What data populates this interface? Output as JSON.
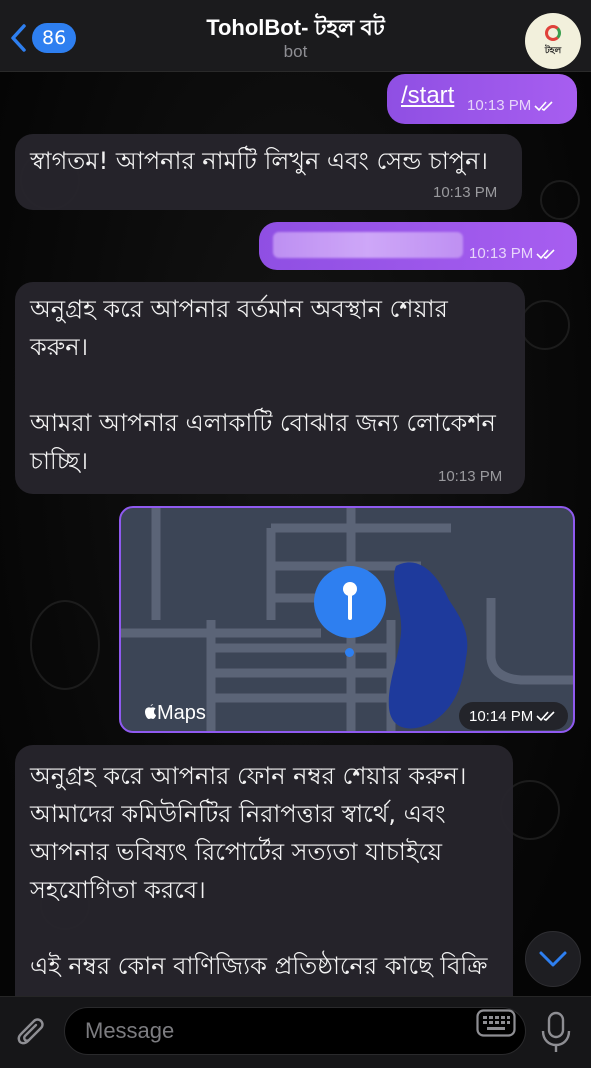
{
  "header": {
    "back_count": "86",
    "title": "ToholBot- টহল বট",
    "subtitle": "bot",
    "avatar_text": "টহল"
  },
  "messages": [
    {
      "direction": "out",
      "text": "/start",
      "time": "10:13 PM"
    },
    {
      "direction": "in",
      "text": "স্বাগতম! আপনার নামটি লিখুন এবং সেন্ড চাপুন।",
      "time": "10:13 PM"
    },
    {
      "direction": "out",
      "text": "",
      "time": "10:13 PM"
    },
    {
      "direction": "in",
      "text": "অনুগ্রহ করে আপনার বর্তমান অবস্থান শেয়ার করুন।\n\nআমরা আপনার এলাকাটি বোঝার জন্য লোকেশন চাচ্ছি।",
      "time": "10:13 PM"
    },
    {
      "direction": "out",
      "type": "map",
      "label": "Maps",
      "time": "10:14 PM"
    },
    {
      "direction": "in",
      "text": "অনুগ্রহ করে আপনার ফোন নম্বর শেয়ার করুন। আমাদের কমিউনিটির নিরাপত্তার স্বার্থে, এবং আপনার ভবিষ্যৎ রিপোর্টের সত্যতা যাচাইয়ে সহযোগিতা করবে।\n\nএই নম্বর কোন বাণিজ্যিক প্রতিষ্ঠানের কাছে বিক্রি"
    }
  ],
  "input": {
    "placeholder": "Message"
  },
  "icons": {
    "back": "chevron-left-icon",
    "attach": "paperclip-icon",
    "keyboard": "keyboard-icon",
    "mic": "microphone-icon",
    "scroll": "chevron-down-icon",
    "pin": "map-pin-icon"
  },
  "colors": {
    "accent": "#2e7ff0",
    "outgoing_bubble": "#9b56ea",
    "incoming_bubble": "#26242c",
    "map_water": "#1e3a9c"
  }
}
